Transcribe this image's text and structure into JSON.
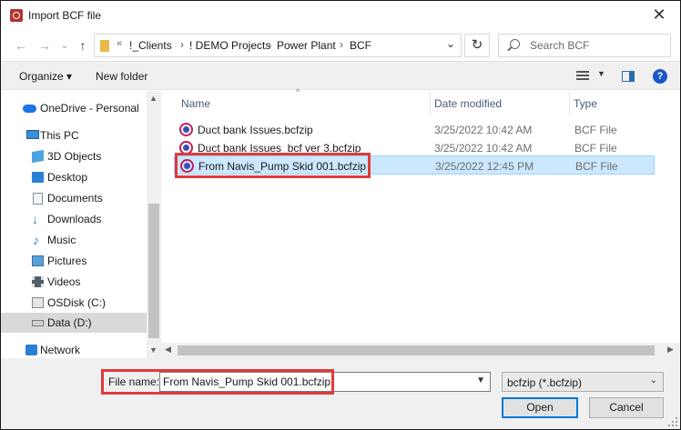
{
  "window": {
    "title": "Import BCF file",
    "close_label": "✕"
  },
  "nav": {
    "back": "←",
    "forward": "→",
    "recent": "⌄",
    "up": "↑",
    "breadcrumb_overflow": "«",
    "breadcrumbs": [
      "!_Clients",
      "! DEMO Projects",
      "Power Plant",
      "BCF"
    ],
    "separator": "›",
    "refresh": "↻",
    "search_placeholder": "Search BCF"
  },
  "toolbar": {
    "organize": "Organize ▾",
    "new_folder": "New folder",
    "help": "?"
  },
  "sidebar": {
    "items": [
      {
        "label": "OneDrive - Personal",
        "icon": "cloud-icon",
        "color": "#1a73e8"
      },
      {
        "label": "This PC",
        "icon": "computer-icon",
        "color": "#3a8fd6"
      },
      {
        "label": "3D Objects",
        "icon": "cube-icon",
        "color": "#4aa3df"
      },
      {
        "label": "Desktop",
        "icon": "desktop-icon",
        "color": "#2a7fd4"
      },
      {
        "label": "Documents",
        "icon": "document-icon",
        "color": "#7d8fa8"
      },
      {
        "label": "Downloads",
        "icon": "download-arrow-icon",
        "color": "#2a7fd4"
      },
      {
        "label": "Music",
        "icon": "music-note-icon",
        "color": "#2a7fd4"
      },
      {
        "label": "Pictures",
        "icon": "pictures-icon",
        "color": "#5aa0d8"
      },
      {
        "label": "Videos",
        "icon": "video-icon",
        "color": "#555d6b"
      },
      {
        "label": "OSDisk (C:)",
        "icon": "disk-icon",
        "color": "#8a8a8a"
      },
      {
        "label": "Data (D:)",
        "icon": "drive-icon",
        "color": "#8a8a8a",
        "selected": true
      },
      {
        "label": "Network",
        "icon": "network-icon",
        "color": "#2a7fd4"
      }
    ]
  },
  "columns": {
    "name": "Name",
    "date": "Date modified",
    "type": "Type"
  },
  "files": [
    {
      "name": "Duct bank Issues.bcfzip",
      "date": "3/25/2022 10:42 AM",
      "type": "BCF File"
    },
    {
      "name": "Duct bank Issues_bcf ver 3.bcfzip",
      "date": "3/25/2022 10:42 AM",
      "type": "BCF File"
    },
    {
      "name": "From Navis_Pump Skid 001.bcfzip",
      "date": "3/25/2022 12:45 PM",
      "type": "BCF File",
      "selected": true
    }
  ],
  "bottom": {
    "filename_label": "File name:",
    "filename_value": "From Navis_Pump Skid 001.bcfzip",
    "filter": "bcfzip (*.bcfzip)",
    "open": "Open",
    "cancel": "Cancel"
  },
  "colors": {
    "highlight_box": "#e03a3a",
    "selection": "#cce8ff",
    "accent": "#0078d7"
  }
}
